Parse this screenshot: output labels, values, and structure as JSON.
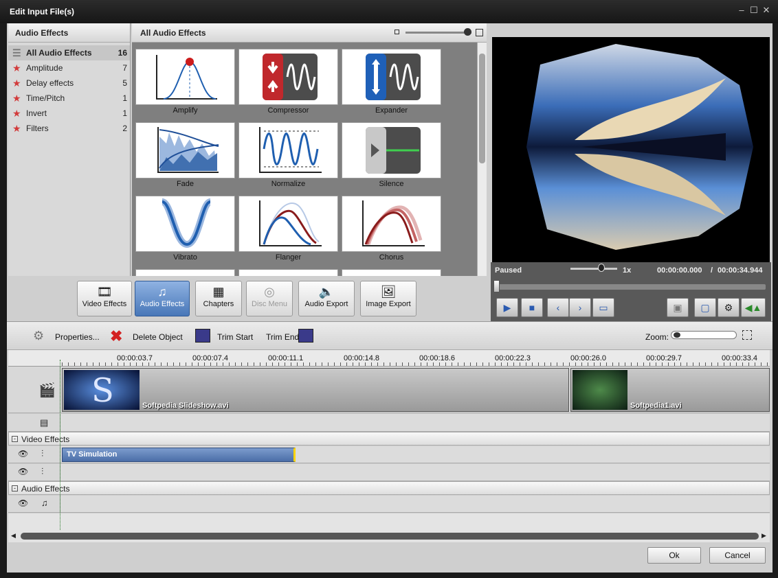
{
  "window": {
    "title": "Edit Input File(s)",
    "min": "‒",
    "max": "☐",
    "close": "✕"
  },
  "category_panel": {
    "header": "Audio Effects",
    "items": [
      {
        "label": "All Audio Effects",
        "count": "16"
      },
      {
        "label": "Amplitude",
        "count": "7"
      },
      {
        "label": "Delay effects",
        "count": "5"
      },
      {
        "label": "Time/Pitch",
        "count": "1"
      },
      {
        "label": "Invert",
        "count": "1"
      },
      {
        "label": "Filters",
        "count": "2"
      }
    ]
  },
  "grid_panel": {
    "header": "All Audio Effects",
    "effects": [
      "Amplify",
      "Compressor",
      "Expander",
      "Fade",
      "Normalize",
      "Silence",
      "Vibrato",
      "Flanger",
      "Chorus"
    ]
  },
  "toolbar": {
    "buttons": [
      "Video Effects",
      "Audio Effects",
      "Chapters",
      "Disc Menu",
      "Audio Export",
      "Image Export"
    ]
  },
  "preview": {
    "status": "Paused",
    "speed": "1x",
    "time_current": "00:00:00.000",
    "time_sep": "/",
    "time_total": "00:00:34.944"
  },
  "timeline_toolbar": {
    "properties": "Properties...",
    "delete": "Delete Object",
    "trim_start": "Trim Start",
    "trim_end": "Trim End",
    "zoom": "Zoom:"
  },
  "ruler": [
    "00:00:03.7",
    "00:00:07.4",
    "00:00:11.1",
    "00:00:14.8",
    "00:00:18.6",
    "00:00:22.3",
    "00:00:26.0",
    "00:00:29.7",
    "00:00:33.4"
  ],
  "clips": {
    "clip1": "Softpedia Slideshow.avi",
    "clip2": "Softpedia1.avi"
  },
  "groups": {
    "video": "Video Effects",
    "audio": "Audio Effects"
  },
  "effect_clip": "TV Simulation",
  "dialog": {
    "ok": "Ok",
    "cancel": "Cancel"
  },
  "colors": {
    "accent": "#4877b8",
    "track_bg": "#dcdcdc",
    "effect_bar": "#5b7fb5"
  }
}
